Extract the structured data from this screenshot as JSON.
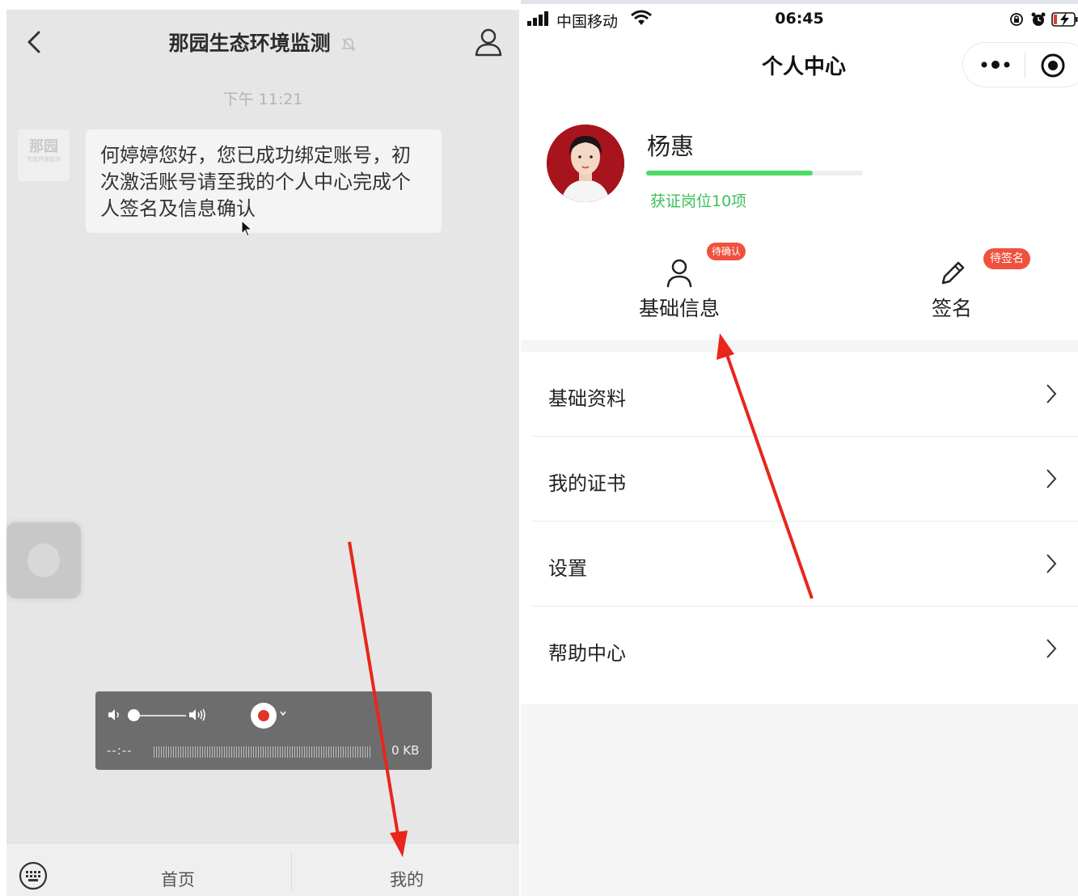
{
  "left_chat": {
    "title": "那园生态环境监测",
    "timestamp": "下午 11:21",
    "avatar_text": "那园",
    "avatar_subtext": "生态环境监测",
    "message": "何婷婷您好，您已成功绑定账号，初次激活账号请至我的个人中心完成个人签名及信息确认",
    "recorder": {
      "elapsed": "--:--",
      "size": "0 KB"
    },
    "tabs": [
      {
        "label": "首页"
      },
      {
        "label": "我的"
      }
    ],
    "icons": [
      "back-icon",
      "mute-icon",
      "profile-icon",
      "mouse-cursor-icon",
      "keyboard-icon",
      "volume-low-icon",
      "volume-high-icon",
      "record-icon"
    ]
  },
  "right_profile": {
    "status_bar": {
      "carrier": "中国移动",
      "time": "06:45"
    },
    "page_title": "个人中心",
    "user": {
      "name": "杨惠",
      "progress": 0.77,
      "cert_text": "获证岗位10项"
    },
    "entries": [
      {
        "label": "基础信息",
        "badge": "待确认",
        "icon": "person-icon"
      },
      {
        "label": "签名",
        "badge": "待签名",
        "icon": "pen-icon"
      }
    ],
    "menu": [
      {
        "label": "基础资料"
      },
      {
        "label": "我的证书"
      },
      {
        "label": "设置"
      },
      {
        "label": "帮助中心"
      }
    ],
    "colors": {
      "progress_green": "#4cd964",
      "badge_red": "#f0513e",
      "annotation_red": "#e8261c"
    }
  }
}
